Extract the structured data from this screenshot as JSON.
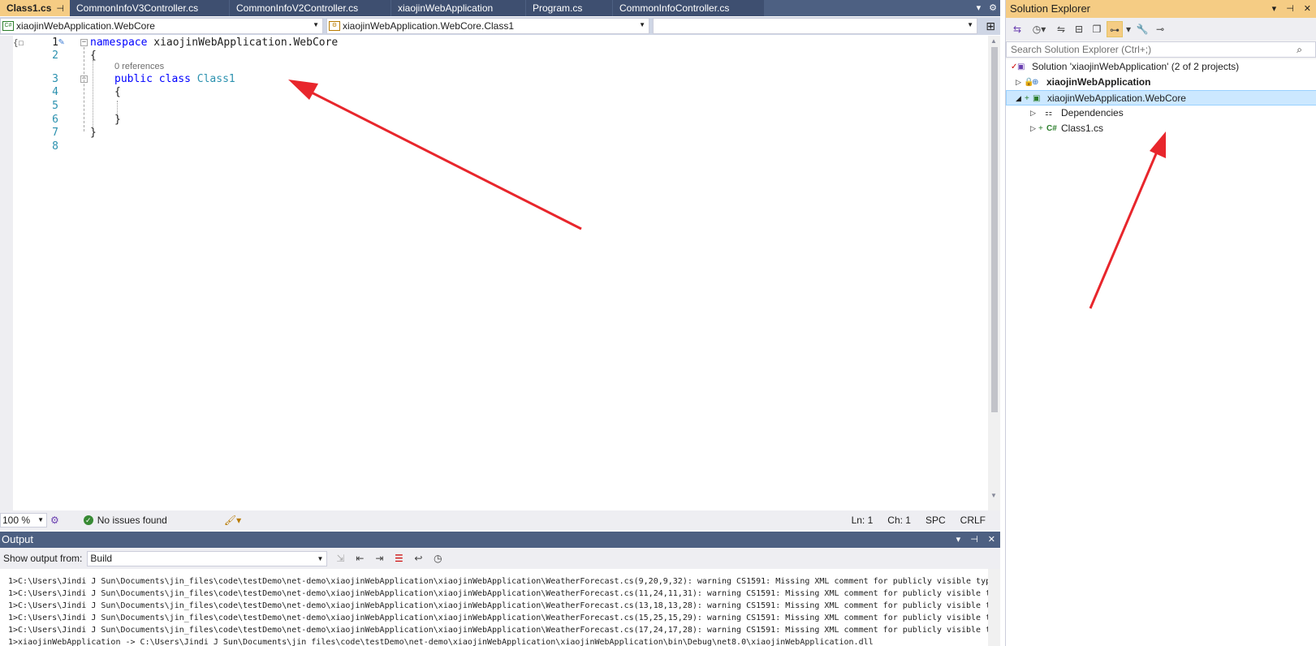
{
  "tabs": [
    {
      "label": "Class1.cs",
      "active": true
    },
    {
      "label": "CommonInfoV3Controller.cs",
      "active": false
    },
    {
      "label": "CommonInfoV2Controller.cs",
      "active": false
    },
    {
      "label": "xiaojinWebApplication",
      "active": false
    },
    {
      "label": "Program.cs",
      "active": false
    },
    {
      "label": "CommonInfoController.cs",
      "active": false
    }
  ],
  "tab_close_glyph": "✕",
  "tab_pin_glyph": "⊣",
  "nav": {
    "project_combo": "xiaojinWebApplication.WebCore",
    "type_combo": "xiaojinWebApplication.WebCore.Class1",
    "member_combo": ""
  },
  "code": {
    "line_numbers": [
      "1",
      "2",
      "3",
      "4",
      "5",
      "6",
      "7",
      "8"
    ],
    "line1_keyword": "namespace",
    "line1_name": "xiaojinWebApplication.WebCore",
    "open_brace": "{",
    "close_brace": "}",
    "codelens": "0 references",
    "line3_kw1": "public",
    "line3_kw2": "class",
    "line3_type": "Class1"
  },
  "status": {
    "zoom": "100 %",
    "issues": "No issues found",
    "line": "Ln: 1",
    "col": "Ch: 1",
    "whitespace": "SPC",
    "line_ending": "CRLF"
  },
  "output": {
    "title": "Output",
    "show_from_label": "Show output from:",
    "source": "Build",
    "lines": [
      "1>C:\\Users\\Jindi J Sun\\Documents\\jin_files\\code\\testDemo\\net-demo\\xiaojinWebApplication\\xiaojinWebApplication\\WeatherForecast.cs(9,20,9,32): warning CS1591: Missing XML comment for publicly visible typ",
      "1>C:\\Users\\Jindi J Sun\\Documents\\jin_files\\code\\testDemo\\net-demo\\xiaojinWebApplication\\xiaojinWebApplication\\WeatherForecast.cs(11,24,11,31): warning CS1591: Missing XML comment for publicly visible t",
      "1>C:\\Users\\Jindi J Sun\\Documents\\jin_files\\code\\testDemo\\net-demo\\xiaojinWebApplication\\xiaojinWebApplication\\WeatherForecast.cs(13,18,13,28): warning CS1591: Missing XML comment for publicly visible t",
      "1>C:\\Users\\Jindi J Sun\\Documents\\jin_files\\code\\testDemo\\net-demo\\xiaojinWebApplication\\xiaojinWebApplication\\WeatherForecast.cs(15,25,15,29): warning CS1591: Missing XML comment for publicly visible t",
      "1>C:\\Users\\Jindi J Sun\\Documents\\jin_files\\code\\testDemo\\net-demo\\xiaojinWebApplication\\xiaojinWebApplication\\WeatherForecast.cs(17,24,17,28): warning CS1591: Missing XML comment for publicly visible t",
      "1>xiaojinWebApplication -> C:\\Users\\Jindi J Sun\\Documents\\jin_files\\code\\testDemo\\net-demo\\xiaojinWebApplication\\xiaojinWebApplication\\bin\\Debug\\net8.0\\xiaojinWebApplication.dll"
    ]
  },
  "solution_explorer": {
    "title": "Solution Explorer",
    "search_placeholder": "Search Solution Explorer (Ctrl+;)",
    "solution_label": "Solution 'xiaojinWebApplication' (2 of 2 projects)",
    "items": [
      {
        "label": "xiaojinWebApplication",
        "bold": true
      },
      {
        "label": "xiaojinWebApplication.WebCore",
        "bold": false,
        "selected": true
      },
      {
        "label": "Dependencies"
      },
      {
        "label": "Class1.cs"
      }
    ]
  },
  "colors": {
    "accent_tab": "#f5cc84",
    "title_bar": "#4d6082",
    "annotation_arrow": "#e8262c",
    "keyword": "#0000ff",
    "type": "#2b91af"
  }
}
